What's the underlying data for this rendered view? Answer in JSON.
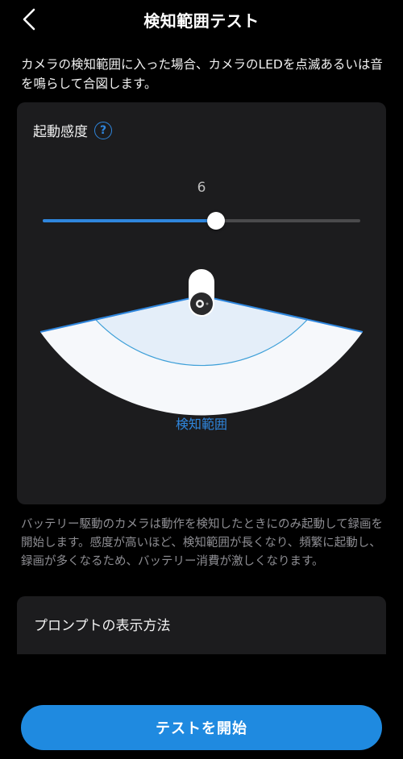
{
  "header": {
    "title": "検知範囲テスト",
    "back_icon": "chevron-left-icon"
  },
  "description": "カメラの検知範囲に入った場合、カメラのLEDを点滅あるいは音を鳴らして合図します。",
  "sensitivity": {
    "label": "起動感度",
    "help_icon": "question-circle-icon",
    "help_glyph": "?",
    "value": "6",
    "fill_fraction": 0.545,
    "range_label": "検知範囲"
  },
  "info_text": "バッテリー駆動のカメラは動作を検知したときにのみ起動して録画を開始します。感度が高いほど、検知範囲が長くなり、頻繁に起動し、録画が多くなるため、バッテリー消費が激しくなります。",
  "prompt_section": {
    "title": "プロンプトの表示方法"
  },
  "start_button": {
    "label": "テストを開始"
  },
  "colors": {
    "accent": "#2f86dd",
    "button": "#1f8ae0",
    "card_bg": "#1c1c1e",
    "background": "#000000"
  }
}
